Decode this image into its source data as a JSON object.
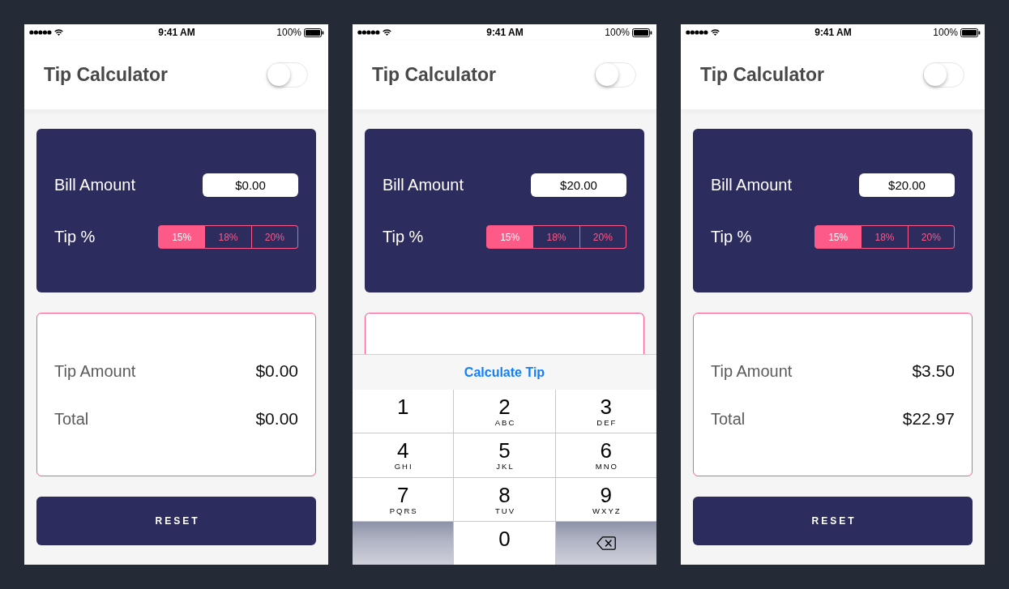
{
  "phones": [
    {
      "status_bar": {
        "time": "9:41 AM",
        "battery": "100%"
      },
      "header": {
        "title": "Tip Calculator",
        "toggle": {
          "on": false
        }
      },
      "bill": {
        "label": "Bill Amount",
        "value": "$0.00"
      },
      "tip": {
        "label": "Tip %",
        "options": [
          {
            "label": "15%",
            "selected": true
          },
          {
            "label": "18%",
            "selected": false
          },
          {
            "label": "20%",
            "selected": false
          }
        ]
      },
      "results": [
        {
          "label": "Tip Amount",
          "value": "$0.00"
        },
        {
          "label": "Total",
          "value": "$0.00"
        }
      ],
      "reset_button": "RESET"
    },
    {
      "status_bar": {
        "time": "9:41 AM",
        "battery": "100%"
      },
      "header": {
        "title": "Tip Calculator",
        "toggle": {
          "on": false
        }
      },
      "bill": {
        "label": "Bill Amount",
        "value": "$20.00"
      },
      "tip": {
        "label": "Tip %",
        "options": [
          {
            "label": "15%",
            "selected": true
          },
          {
            "label": "18%",
            "selected": false
          },
          {
            "label": "20%",
            "selected": false
          }
        ]
      },
      "keyboard": {
        "action": "Calculate Tip",
        "keys": [
          {
            "kind": "digit",
            "digit": "1"
          },
          {
            "kind": "digit",
            "digit": "2",
            "letters": "ABC"
          },
          {
            "kind": "digit",
            "digit": "3",
            "letters": "DEF"
          },
          {
            "kind": "digit",
            "digit": "4",
            "letters": "GHI"
          },
          {
            "kind": "digit",
            "digit": "5",
            "letters": "JKL"
          },
          {
            "kind": "digit",
            "digit": "6",
            "letters": "MNO"
          },
          {
            "kind": "digit",
            "digit": "7",
            "letters": "PQRS"
          },
          {
            "kind": "digit",
            "digit": "8",
            "letters": "TUV"
          },
          {
            "kind": "digit",
            "digit": "9",
            "letters": "WXYZ"
          },
          {
            "kind": "blank"
          },
          {
            "kind": "digit",
            "digit": "0"
          },
          {
            "kind": "delete"
          }
        ]
      }
    },
    {
      "status_bar": {
        "time": "9:41 AM",
        "battery": "100%"
      },
      "header": {
        "title": "Tip Calculator",
        "toggle": {
          "on": false
        }
      },
      "bill": {
        "label": "Bill Amount",
        "value": "$20.00"
      },
      "tip": {
        "label": "Tip %",
        "options": [
          {
            "label": "15%",
            "selected": true
          },
          {
            "label": "18%",
            "selected": false
          },
          {
            "label": "20%",
            "selected": false
          }
        ]
      },
      "results": [
        {
          "label": "Tip Amount",
          "value": "$3.50"
        },
        {
          "label": "Total",
          "value": "$22.97"
        }
      ],
      "reset_button": "RESET"
    }
  ]
}
